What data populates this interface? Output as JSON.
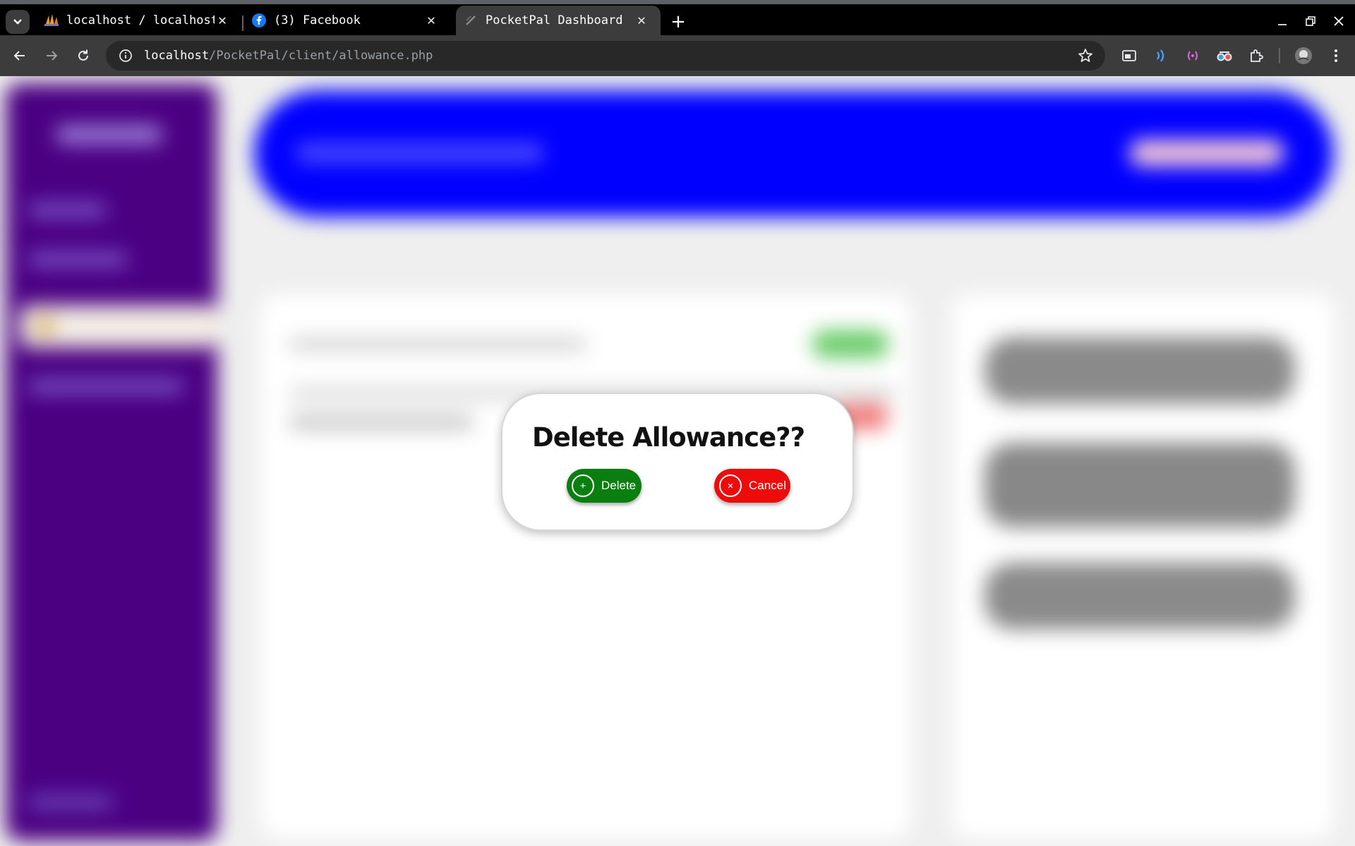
{
  "browser": {
    "tabs": [
      {
        "title": "localhost / localhost",
        "favicon": "phpmyadmin-icon",
        "active": false
      },
      {
        "title": "(3) Facebook",
        "favicon": "facebook-icon",
        "active": false
      },
      {
        "title": "PocketPal Dashboard",
        "favicon": "page-icon",
        "active": true
      }
    ],
    "new_tab_label": "+",
    "close_glyph": "✕",
    "url": {
      "host": "localhost",
      "path": "/PocketPal/client/allowance.php"
    }
  },
  "modal": {
    "title": "Delete Allowance??",
    "delete_label": "Delete",
    "delete_glyph": "+",
    "cancel_label": "Cancel",
    "cancel_glyph": "×",
    "delete_color": "#0b7e10",
    "cancel_color": "#ee0b0b"
  },
  "colors": {
    "sidebar": "#4b0082",
    "header_banner": "#0000ff"
  }
}
